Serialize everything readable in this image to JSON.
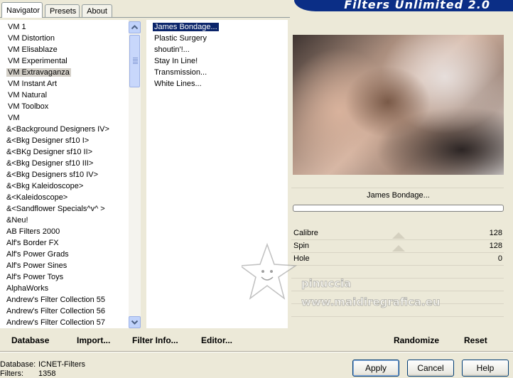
{
  "tabs": [
    {
      "label": "Navigator",
      "active": true
    },
    {
      "label": "Presets",
      "active": false
    },
    {
      "label": "About",
      "active": false
    }
  ],
  "banner": {
    "title": "Filters Unlimited 2.0"
  },
  "categories": [
    "VM 1",
    "VM Distortion",
    "VM Elisablaze",
    "VM Experimental",
    "VM Extravaganza",
    "VM Instant Art",
    "VM Natural",
    "VM Toolbox",
    "VM",
    "&<Background Designers IV>",
    "&<Bkg Designer sf10 I>",
    "&<BKg Designer sf10 II>",
    "&<Bkg Designer sf10 III>",
    "&<Bkg Designers sf10 IV>",
    "&<Bkg Kaleidoscope>",
    "&<Kaleidoscope>",
    "&<Sandflower Specials^v^ >",
    "&Neu!",
    "AB Filters 2000",
    "Alf's Border FX",
    "Alf's Power Grads",
    "Alf's Power Sines",
    "Alf's Power Toys",
    "AlphaWorks",
    "Andrew's Filter Collection 55",
    "Andrew's Filter Collection 56",
    "Andrew's Filter Collection 57"
  ],
  "selected_category": "VM Extravaganza",
  "filters": [
    "James Bondage...",
    "Plastic Surgery",
    "shoutin'!...",
    "Stay In Line!",
    "Transmission...",
    "White Lines..."
  ],
  "selected_filter": "James Bondage...",
  "filter_title": "James Bondage...",
  "params": [
    {
      "name": "Calibre",
      "value": "128",
      "level": 0.5
    },
    {
      "name": "Spin",
      "value": "128",
      "level": 0.5
    },
    {
      "name": "Hole",
      "value": "0",
      "level": 0
    }
  ],
  "buttons": {
    "database": "Database",
    "import": "Import...",
    "filter_info": "Filter Info...",
    "editor": "Editor...",
    "randomize": "Randomize",
    "reset": "Reset",
    "apply": "Apply",
    "cancel": "Cancel",
    "help": "Help"
  },
  "status": {
    "database_label": "Database:",
    "database_value": "ICNET-Filters",
    "filters_label": "Filters:",
    "filters_value": "1358"
  },
  "watermark": {
    "name": "pinuccia",
    "url": "www.maidiregrafica.eu"
  },
  "colors": {
    "banner": "#0b2e86",
    "selection": "#0a246a",
    "panel_bg": "#ece9d8"
  }
}
